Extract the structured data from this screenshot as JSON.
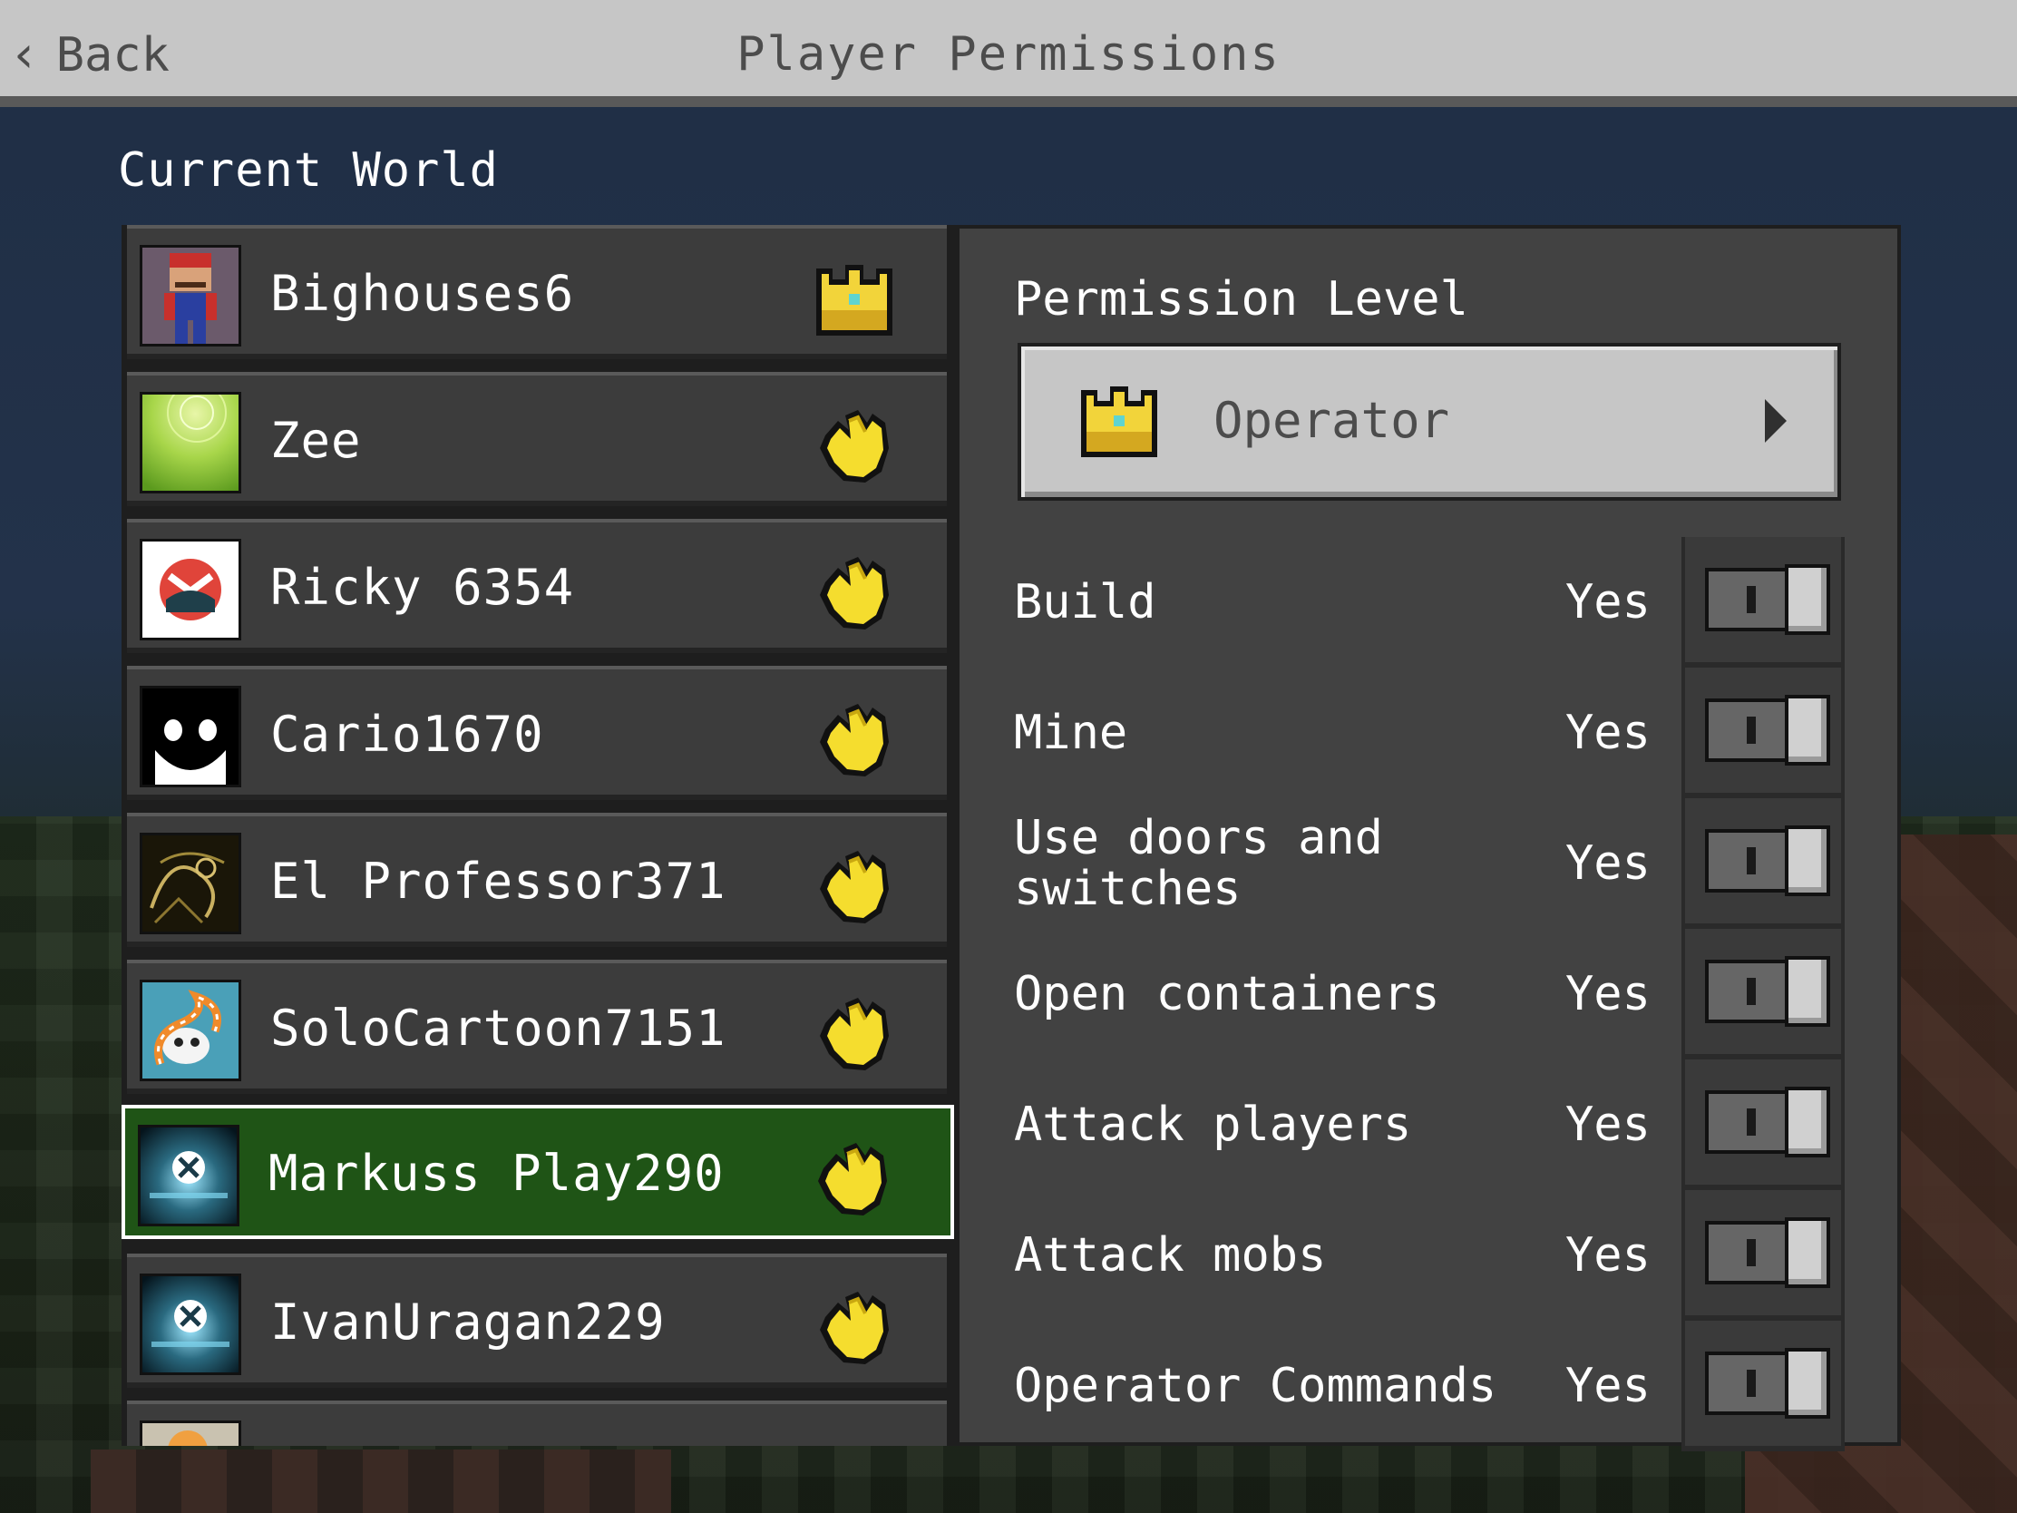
{
  "header": {
    "back_label": "Back",
    "title": "Player Permissions"
  },
  "section_title": "Current World",
  "players": [
    {
      "name": "Bighouses6",
      "icon": "crown-icon",
      "avatar": "mario-skin"
    },
    {
      "name": "Zee",
      "icon": "hand-icon",
      "avatar": "green-swirl"
    },
    {
      "name": "Ricky 6354",
      "icon": "hand-icon",
      "avatar": "xbox-red-logo"
    },
    {
      "name": "Cario1670",
      "icon": "hand-icon",
      "avatar": "smiley-face"
    },
    {
      "name": "El Professor371",
      "icon": "hand-icon",
      "avatar": "dragon-art"
    },
    {
      "name": "SoloCartoon7151",
      "icon": "hand-icon",
      "avatar": "snake-skull"
    },
    {
      "name": "Markuss Play290",
      "icon": "hand-icon",
      "avatar": "xbox-logo",
      "selected": true
    },
    {
      "name": "IvanUragan229",
      "icon": "hand-icon",
      "avatar": "xbox-logo"
    }
  ],
  "permissions": {
    "level_label": "Permission Level",
    "level_value": "Operator",
    "items": [
      {
        "label": "Build",
        "value": "Yes"
      },
      {
        "label": "Mine",
        "value": "Yes"
      },
      {
        "label": "Use doors and switches",
        "value": "Yes"
      },
      {
        "label": "Open containers",
        "value": "Yes"
      },
      {
        "label": "Attack players",
        "value": "Yes"
      },
      {
        "label": "Attack mobs",
        "value": "Yes"
      },
      {
        "label": "Operator Commands",
        "value": "Yes"
      }
    ]
  },
  "colors": {
    "header_bg": "#c6c6c6",
    "row_bg": "#3c3c3c",
    "selected_row_bg": "#1f5416",
    "panel_bg": "#424242",
    "crown_gold": "#f2d43a",
    "hand_yellow": "#f5dd2e"
  }
}
